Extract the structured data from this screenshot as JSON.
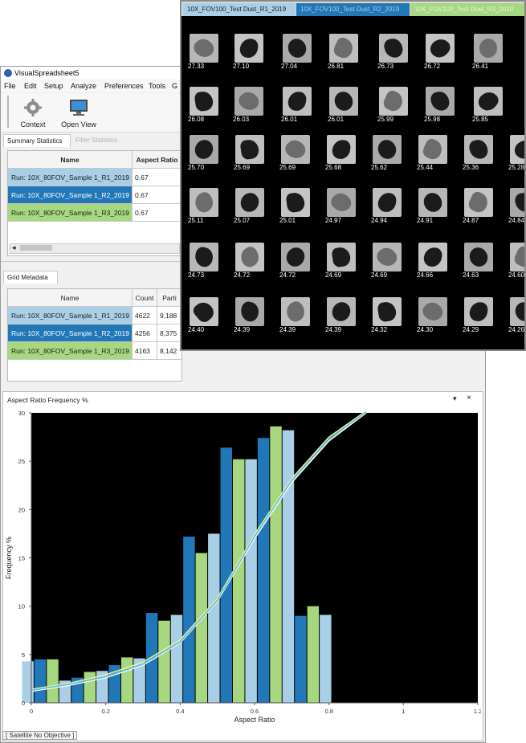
{
  "main_window": {
    "title": "VisualSpreadsheet5",
    "menu": [
      "File",
      "Edit",
      "Setup",
      "Analyze",
      "Preferences",
      "Tools",
      "G"
    ],
    "toolbar": {
      "context_label": "Context",
      "open_view_label": "Open View"
    }
  },
  "summary": {
    "tabs": [
      "Summary Statistics",
      "Filter Statistics"
    ],
    "headers": [
      "Name",
      "Aspect Ratio"
    ],
    "rows": [
      {
        "name": "Run: 10X_80FOV_Sample 1_R1_2019",
        "aspect_ratio": "0.67",
        "color": "#a9cfe6"
      },
      {
        "name": "Run: 10X_80FOV_Sample 1_R2_2019",
        "aspect_ratio": "0.67",
        "color": "#2277b6"
      },
      {
        "name": "Run: 10X_80FOV_Sample 1_R3_2019",
        "aspect_ratio": "0.67",
        "color": "#a7d780"
      }
    ],
    "scroll_left_arrow": "◂"
  },
  "grid_metadata": {
    "tab": "Grid Metadata",
    "headers": [
      "Name",
      "Count",
      "Parti"
    ],
    "rows": [
      {
        "name": "Run: 10X_80FOV_Sample 1_R1_2019",
        "count": "4622",
        "particles": "9,188"
      },
      {
        "name": "Run: 10X_80FOV_Sample 1_R2_2019",
        "count": "4256",
        "particles": "8,375"
      },
      {
        "name": "Run: 10X_80FOV_Sample 1_R3_2019",
        "count": "4163",
        "particles": "8,142"
      }
    ]
  },
  "chart_panel": {
    "title": "Aspect Ratio Frequency %",
    "pin_icon": "▾",
    "close_icon": "×",
    "status": "[ Satellite No Objective ]"
  },
  "chart_data": {
    "type": "bar",
    "title": "",
    "xlabel": "Aspect Ratio",
    "ylabel": "Frequency %",
    "xlim": [
      0,
      1.2
    ],
    "ylim": [
      0,
      30
    ],
    "x_ticks": [
      "0",
      "0.2",
      "0.4",
      "0.6",
      "0.8",
      "1",
      "1.2"
    ],
    "y_ticks": [
      "0",
      "5",
      "10",
      "15",
      "20",
      "25",
      "30"
    ],
    "bin_centers": [
      0.025,
      0.125,
      0.225,
      0.325,
      0.425,
      0.525,
      0.625,
      0.725,
      0.825,
      0.925,
      1.025
    ],
    "series": [
      {
        "color": "#a9cfe6",
        "values": [
          4.3,
          2.3,
          3.3,
          4.6,
          9.1,
          17.5,
          25.2,
          28.2,
          9.1,
          0,
          0
        ]
      },
      {
        "color": "#2277b6",
        "values": [
          4.5,
          2.6,
          3.9,
          9.3,
          17.2,
          26.4,
          27.4,
          9.0,
          0,
          0,
          0
        ]
      },
      {
        "color": "#a7d780",
        "values": [
          4.5,
          3.2,
          4.7,
          8.5,
          15.5,
          25.2,
          28.6,
          10.0,
          0,
          0,
          0
        ]
      }
    ],
    "curves": [
      {
        "color": "#ffffff",
        "points": [
          [
            0.0,
            1.2
          ],
          [
            0.1,
            1.8
          ],
          [
            0.2,
            2.6
          ],
          [
            0.3,
            3.9
          ],
          [
            0.4,
            6.2
          ],
          [
            0.5,
            10.5
          ],
          [
            0.6,
            17.0
          ],
          [
            0.7,
            22.8
          ],
          [
            0.8,
            27.1
          ],
          [
            0.9,
            30.0
          ]
        ]
      },
      {
        "color": "#e8f28c",
        "points": [
          [
            0.0,
            1.4
          ],
          [
            0.1,
            2.0
          ],
          [
            0.2,
            2.9
          ],
          [
            0.3,
            4.2
          ],
          [
            0.4,
            6.5
          ],
          [
            0.5,
            10.8
          ],
          [
            0.6,
            17.4
          ],
          [
            0.7,
            23.2
          ],
          [
            0.8,
            27.5
          ],
          [
            0.9,
            30.2
          ]
        ]
      },
      {
        "color": "#5bb8e8",
        "points": [
          [
            0.0,
            1.3
          ],
          [
            0.1,
            1.9
          ],
          [
            0.2,
            2.7
          ],
          [
            0.3,
            4.0
          ],
          [
            0.4,
            6.3
          ],
          [
            0.5,
            10.6
          ],
          [
            0.6,
            17.2
          ],
          [
            0.7,
            23.0
          ],
          [
            0.8,
            27.3
          ],
          [
            0.9,
            30.1
          ]
        ]
      }
    ],
    "background": "#000000",
    "grid": false
  },
  "gallery": {
    "tabs": [
      "10X_FOV100_Test Dust_R1_2019",
      "10X_FOV100_Test Dust_R2_2019",
      "10X_FOV100_Test Dust_R3_2019"
    ],
    "tab_colors": [
      "#a9cfe6",
      "#2277b6",
      "#a7d780"
    ],
    "rows": [
      [
        "27.33",
        "27.10",
        "27.04",
        "26.81",
        "26.73",
        "26.72",
        "26.41"
      ],
      [
        "26.08",
        "26.03",
        "26.01",
        "26.01",
        "25.99",
        "25.98",
        "25.85"
      ],
      [
        "25.70",
        "25.69",
        "25.69",
        "25.68",
        "25.62",
        "25.44",
        "25.36",
        "25.28"
      ],
      [
        "25.11",
        "25.07",
        "25.01",
        "24.97",
        "24.94",
        "24.91",
        "24.87",
        "24.84"
      ],
      [
        "24.73",
        "24.72",
        "24.72",
        "24.69",
        "24.69",
        "24.66",
        "24.63",
        "24.60"
      ],
      [
        "24.40",
        "24.39",
        "24.39",
        "24.39",
        "24.32",
        "24.30",
        "24.29",
        "24.26"
      ]
    ]
  }
}
